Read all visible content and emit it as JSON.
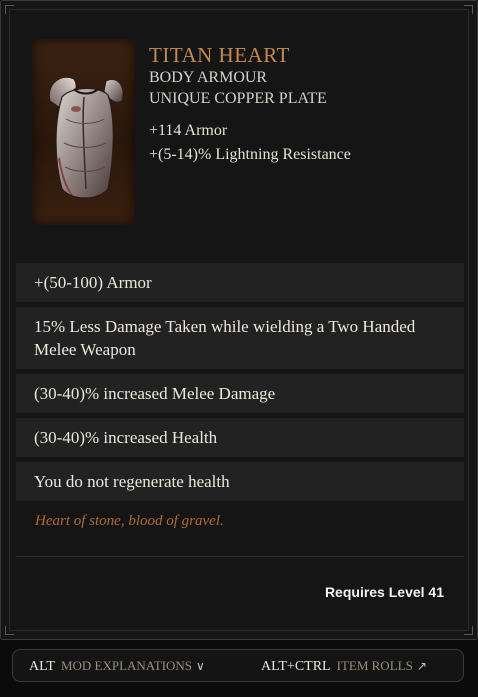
{
  "item": {
    "name": "TITAN HEART",
    "type_lines": [
      "BODY ARMOUR",
      "UNIQUE COPPER PLATE"
    ],
    "base_stats": [
      "+114 Armor",
      "+(5-14)% Lightning Resistance"
    ]
  },
  "affixes": [
    "+(50-100) Armor",
    "15% Less Damage Taken while wielding a Two Handed Melee Weapon",
    "(30-40)% increased Melee Damage",
    "(30-40)% increased Health",
    "You do not regenerate health"
  ],
  "flavor_text": "Heart of stone, blood of gravel.",
  "requirement": "Requires Level 41",
  "footer": {
    "mod_key": "ALT",
    "mod_label": "MOD EXPLANATIONS",
    "mod_icon": "chevron-down-icon",
    "roll_key": "ALT+CTRL",
    "roll_label": "ITEM ROLLS",
    "roll_icon": "arrow-up-right-icon"
  },
  "colors": {
    "item_name": "#c48a4d",
    "flavor": "#b06a38",
    "affix_bg": "#222222"
  }
}
